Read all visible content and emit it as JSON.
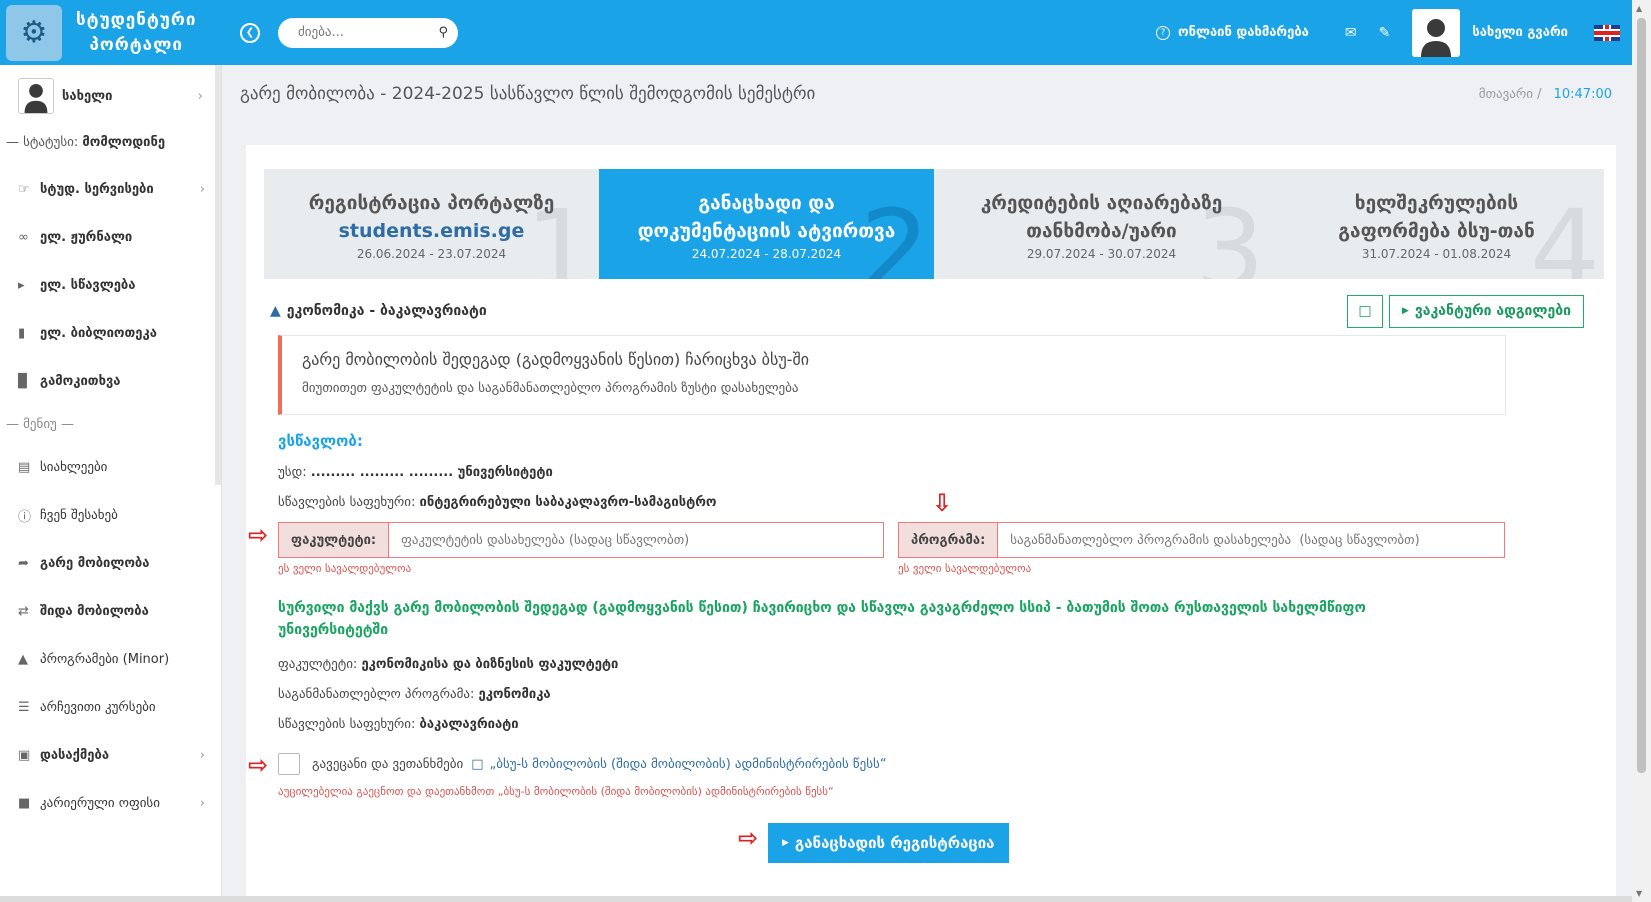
{
  "header": {
    "logo_line1": "სტუდენტური",
    "logo_line2": "პორტალი",
    "search_placeholder": "ძიება...",
    "help_label": "ონლაინ დახმარება",
    "user_name": "სახელი გვარი"
  },
  "sidebar": {
    "user_name": "სახელი",
    "status_label": "— სტატუსი:",
    "status_value": "მომლოდინე",
    "items_top": [
      {
        "label": "სტუდ. სერვისები",
        "icon": "thumb-icon",
        "chevron": true
      },
      {
        "label": "ელ. ჟურნალი",
        "icon": "link-icon",
        "chevron": false
      },
      {
        "label": "ელ. სწავლება",
        "icon": "megaphone-icon",
        "chevron": false
      },
      {
        "label": "ელ. ბიბლიოთეკა",
        "icon": "book-icon",
        "chevron": false
      },
      {
        "label": "გამოკითხვა",
        "icon": "bar-chart-icon",
        "chevron": false
      }
    ],
    "menu_header": "— მენიუ —",
    "items_menu": [
      {
        "label": "სიახლეები",
        "icon": "clipboard-icon",
        "bold": false,
        "chevron": false
      },
      {
        "label": "ჩვენ შესახებ",
        "icon": "info-icon",
        "bold": false,
        "chevron": false
      },
      {
        "label": "გარე მობილობა",
        "icon": "share-icon",
        "bold": true,
        "chevron": false
      },
      {
        "label": "შიდა მობილობა",
        "icon": "shuffle-icon",
        "bold": true,
        "chevron": false
      },
      {
        "label": "პროგრამები (Minor)",
        "icon": "graduation-icon",
        "bold": false,
        "chevron": false
      },
      {
        "label": "არჩევითი კურსები",
        "icon": "database-icon",
        "bold": false,
        "chevron": false
      },
      {
        "label": "დასაქმება",
        "icon": "briefcase-icon",
        "bold": true,
        "chevron": true
      },
      {
        "label": "კარიერული ოფისი",
        "icon": "office-icon",
        "bold": false,
        "chevron": true
      }
    ]
  },
  "page": {
    "title": "გარე მობილობა - 2024-2025 სასწავლო წლის შემოდგომის სემესტრი",
    "breadcrumb_home": "მთავარი",
    "breadcrumb_sep": "/",
    "time": "10:47:00"
  },
  "steps": [
    {
      "num": "1",
      "title_a": "რეგისტრაცია პორტალზე",
      "title_b": "students.emis.ge",
      "dates": "26.06.2024 - 23.07.2024",
      "active": false
    },
    {
      "num": "2",
      "title_a": "განაცხადი და",
      "title_b": "დოკუმენტაციის ატვირთვა",
      "dates": "24.07.2024 - 28.07.2024",
      "active": true
    },
    {
      "num": "3",
      "title_a": "კრედიტების აღიარებაზე",
      "title_b": "თანხმობა/უარი",
      "dates": "29.07.2024 - 30.07.2024",
      "active": false
    },
    {
      "num": "4",
      "title_a": "ხელშეკრულების",
      "title_b": "გაფორმება ბსუ-თან",
      "dates": "31.07.2024 - 01.08.2024",
      "active": false
    }
  ],
  "program": {
    "label": "ეკონომიკა - ბაკალავრიატი",
    "vacancies_button": "ვაკანტური ადგილები"
  },
  "notice": {
    "title": "გარე მობილობის შედეგად (გადმოყვანის წესით) ჩარიცხვა ბსუ-ში",
    "text": "მიუთითეთ ფაკულტეტის და საგანმანათლებლო პროგრამის ზუსტი დასახელება"
  },
  "study": {
    "heading": "ვსწავლობ:",
    "uni_label": "უსდ:",
    "uni_value": "......... ......... ......... უნივერსიტეტი",
    "level_label": "სწავლების საფეხური:",
    "level_value": "ინტეგრირებული საბაკალავრო-სამაგისტრო"
  },
  "fields": {
    "faculty_label": "ფაკულტეტი:",
    "faculty_placeholder": "ფაკულტეტის დასახელება (სადაც სწავლობთ)",
    "program_label": "პროგრამა:",
    "program_placeholder": "საგანმანათლებლო პროგრამის დასახელება  (სადაც სწავლობთ)",
    "required_error": "ეს ველი სავალდებულოა"
  },
  "target": {
    "statement": "სურვილი მაქვს გარე მობილობის შედეგად (გადმოყვანის წესით) ჩავირიცხო და სწავლა გავაგრძელო სსიპ - ბათუმის შოთა რუსთაველის სახელმწიფო უნივერსიტეტში",
    "faculty_label": "ფაკულტეტი:",
    "faculty_value": "ეკონომიკისა და ბიზნესის ფაკულტეტი",
    "program_label": "საგანმანათლებლო პროგრამა:",
    "program_value": "ეკონომიკა",
    "level_label": "სწავლების საფეხური:",
    "level_value": "ბაკალავრიატი"
  },
  "agreement": {
    "text": "გავეცანი და ვეთანხმები",
    "link": "„ბსუ-ს მობილობის (შიდა მობილობის) ადმინისტრირების წესს“",
    "error": "აუცილებელია გაეცნოთ და დაეთანხმოთ „ბსუ-ს მობილობის (შიდა მობილობის) ადმინისტრირების წესს“"
  },
  "submit_label": "განაცხადის რეგისტრაცია"
}
